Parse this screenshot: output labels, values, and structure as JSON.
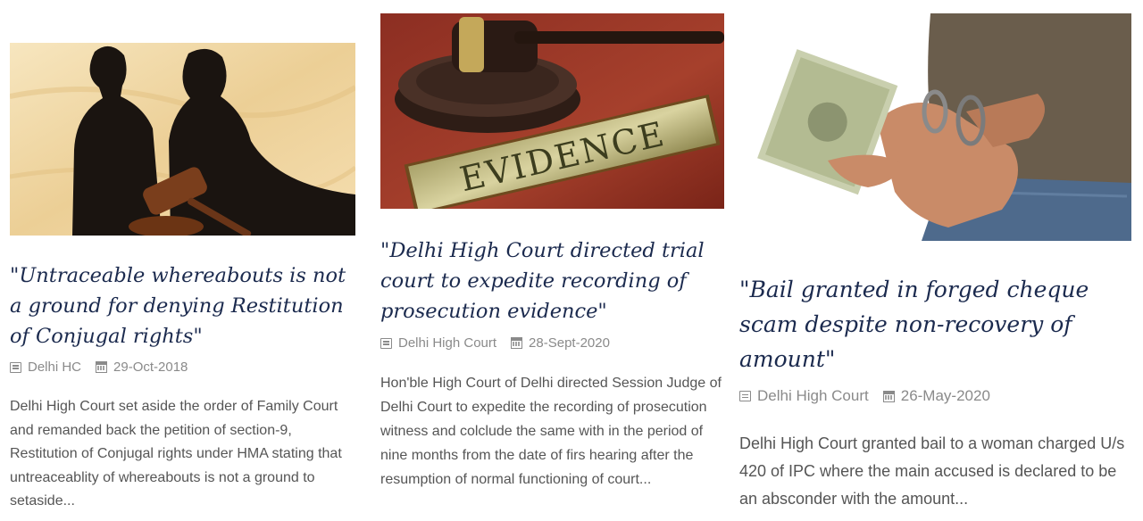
{
  "articles": [
    {
      "title": "\"Untraceable whereabouts is not a ground for denying Restitution of Conjugal rights\"",
      "category": "Delhi HC",
      "date": "29-Oct-2018",
      "excerpt": "Delhi High Court set aside the order of Family Court and remanded back the petition of section-9, Restitution of Conjugal rights under HMA stating that untreaceablity of whereabouts is not a ground to setaside...",
      "image_icon": "gavel-couple-silhouette-image"
    },
    {
      "title": "\"Delhi High Court directed trial court to expedite recording of prosecution evidence\"",
      "category": "Delhi High Court",
      "date": "28-Sept-2020",
      "excerpt": "Hon'ble High Court of Delhi directed Session Judge of Delhi Court to expedite the recording of prosecution witness and colclude the same with in the period of nine months from the date of firs hearing after the resumption of normal functioning of court...",
      "image_icon": "gavel-evidence-plaque-image",
      "image_text": "EVIDENCE"
    },
    {
      "title": "\"Bail granted in forged cheque scam despite non-recovery of amount\"",
      "category": "Delhi High Court",
      "date": "26-May-2020",
      "excerpt": "Delhi High Court granted bail to a woman charged U/s 420 of IPC where the main accused is declared to be an absconder with the amount...",
      "image_icon": "handcuffed-hands-money-image"
    }
  ],
  "icons": {
    "category": "list-icon",
    "date": "calendar-icon"
  },
  "colors": {
    "title": "#1b2a4e",
    "meta": "#8a8a8a",
    "excerpt": "#555555"
  }
}
